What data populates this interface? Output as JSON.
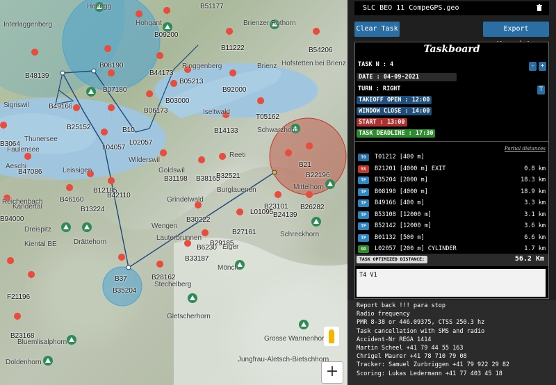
{
  "file": {
    "name": "SLC BEO 11 CompeGPS.geo",
    "delete_icon": "trash-icon"
  },
  "buttons": {
    "clear": "Clear Task",
    "export": "Export Waypoints"
  },
  "taskboard": {
    "title": "Taskboard",
    "task_n": "TASK N : 4",
    "date": "DATE : 04-09-2021",
    "turn": "TURN : RIGHT",
    "takeoff": "TAKEOFF OPEN : 12:00",
    "window_close": "WINDOW CLOSE : 14:00",
    "start": "START : 13:00",
    "deadline": "TASK DEADLINE : 17:30",
    "minus": "-",
    "plus": "+",
    "t_btn": "T",
    "partial_header": "Partial distances",
    "points": [
      {
        "type": "TO",
        "name": "T01212 [400 m]",
        "dist": "",
        "color": "#2b6ea3"
      },
      {
        "type": "SS",
        "name": "B21201 [4000 m] EXIT",
        "dist": "0.8 km",
        "color": "#c0392b"
      },
      {
        "type": "TP",
        "name": "B35204 [2000 m]",
        "dist": "18.3 km",
        "color": "#2e86c1"
      },
      {
        "type": "TP",
        "name": "B08190 [4000 m]",
        "dist": "18.9 km",
        "color": "#2e86c1"
      },
      {
        "type": "TP",
        "name": "B49166 [400 m]",
        "dist": "3.3 km",
        "color": "#2e86c1"
      },
      {
        "type": "TP",
        "name": "B53108 [12000 m]",
        "dist": "3.1 km",
        "color": "#2e86c1"
      },
      {
        "type": "TP",
        "name": "B52142 [12000 m]",
        "dist": "3.6 km",
        "color": "#2e86c1"
      },
      {
        "type": "TP",
        "name": "B01132 [500 m]",
        "dist": "6.6 km",
        "color": "#2e86c1"
      },
      {
        "type": "GO",
        "name": "L02057 [200 m] CYLINDER",
        "dist": "1.7 km",
        "color": "#2e8b2e"
      }
    ],
    "optimized_label": "TASK OPTIMIZED DISTANCE:",
    "optimized_value": "56.2 Km",
    "notes": "T4 V1"
  },
  "info_lines": [
    "Report back !!! para stop",
    "Radio frequency",
    "PMR 8-38 or 446.09375, CTSS 250.3 hz",
    "Task cancellation with SMS and radio",
    "Accident-Nr REGA 1414",
    "Martin Scheel +41 79 44 55 163",
    "Chrigel Maurer +41 78 710 79 08",
    "Tracker: Samuel Zurbriggen +41 79 922 29 82",
    "Scoring: Lukas Ledermann +41 77 403 45 18"
  ],
  "map": {
    "waypoints": [
      "B51177",
      "B09200",
      "B11222",
      "B54206",
      "B48139",
      "B08190",
      "B44173",
      "B07180",
      "B05213",
      "B92000",
      "B49166",
      "B03000",
      "B06173",
      "B25152",
      "T05162",
      "B14133",
      "L04057",
      "L02057",
      "B10",
      "B21",
      "B22196",
      "B12185",
      "B42110",
      "B31198",
      "B38165",
      "B32521",
      "B46160",
      "B13224",
      "B23101",
      "L01095",
      "B24139",
      "B26282",
      "B30222",
      "B27161",
      "B6230",
      "B29185",
      "B33187",
      "B35204",
      "B28162",
      "F21196",
      "B23168",
      "B37",
      "B47086",
      "B3064",
      "B94000"
    ],
    "places": [
      "Honegg",
      "Interlaggenberg",
      "Hohgant",
      "Brienzer Rothorn",
      "Brienz",
      "Hofstetten bei Brienz",
      "Sigriswil",
      "Iseltwald",
      "Thunersee",
      "Faulensee",
      "Aeschi",
      "Leissigen",
      "Wilderswil",
      "Schwarzhorn",
      "Reeti",
      "Burglauenen",
      "Mittelhorn",
      "Kandertal",
      "Dreispitz",
      "Drättehorn",
      "Schreckhorn",
      "Eiger",
      "Mönch",
      "Gletscherhorn",
      "Bluemlisalphorn",
      "Doldenhorn",
      "Jungfrau-Aletsch-Bietschhorn",
      "Grosse Wannenhorn",
      "Lauterbrunnen",
      "Wengen",
      "Stechelberg",
      "Goldswil",
      "Reichenbach",
      "Kiental BE",
      "Ringgenberg",
      "Grindelwald"
    ],
    "zoom_in": "+"
  }
}
